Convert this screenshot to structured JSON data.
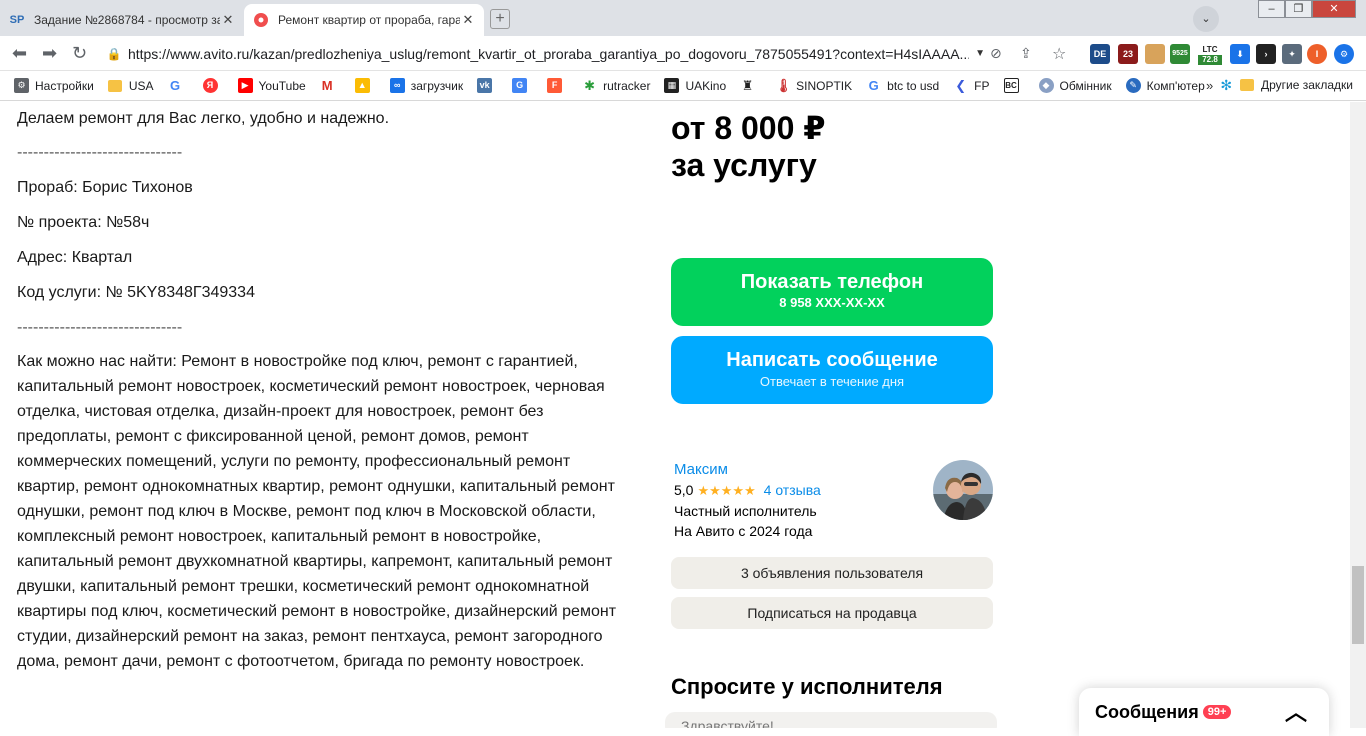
{
  "browser": {
    "tabs": [
      {
        "favicon": "SP",
        "title": "Задание №2868784 - просмотр за"
      },
      {
        "favicon": "avito-icon",
        "title": "Ремонт квартир от прораба, гара"
      }
    ],
    "url": "https://www.avito.ru/kazan/predlozheniya_uslug/remont_kvartir_ot_prorabа_garantiya_po_dogovoru_7875055491?context=H4sIAAAA...",
    "extensions": {
      "ltc_label": "LTC",
      "ltc_value": "72.8",
      "badge_23": "23",
      "badge_de": "DE",
      "badge_num": "9525",
      "profile_initial": "I"
    },
    "bookmarks": [
      "Настройки",
      "USA",
      "",
      "",
      "YouTube",
      "",
      "",
      "загрузчик",
      "",
      "",
      "",
      "rutracker",
      "UAKino",
      "",
      "SINOPTIK",
      "btc to usd",
      "FP",
      "",
      "Обмінник",
      "Комп'ютер",
      ""
    ],
    "bookmarks_more": "»",
    "bookmarks_other": "Другие закладки"
  },
  "page": {
    "intro_line": "Делаем ремонт для Вас легко, удобно и надежно.",
    "divider": "-------------------------------",
    "foreman": "Прораб: Борис Тихонов",
    "project": "№ проекта: №58ч",
    "address": "Адрес: Квартал",
    "service_code": "Код услуги: № 5KY8348Г349334",
    "search_text": "Как можно нас найти: Ремонт в новостройке под ключ, ремонт с гарантией, капитальный ремонт новостроек, косметический ремонт новостроек, черновая отделка, чистовая отделка, дизайн-проект для новостроек, ремонт без предоплаты, ремонт с фиксированной ценой, ремонт домов, ремонт коммерческих помещений, услуги по ремонту, профессиональный ремонт квартир, ремонт однокомнатных квартир, ремонт однушки, капитальный ремонт однушки, ремонт под ключ в Москве, ремонт под ключ в Московской области, комплексный ремонт новостроек, капитальный ремонт в новостройке, капитальный ремонт двухкомнатной квартиры, капремонт, капитальный ремонт двушки, капитальный ремонт трешки, косметический ремонт однокомнатной квартиры под ключ, косметический ремонт в новостройке, дизайнерский ремонт студии, дизайнерский ремонт на заказ, ремонт пентхауса, ремонт загородного дома, ремонт дачи, ремонт с фотоотчетом, бригада по ремонту новостроек.",
    "price_line1": "от 8 000 ₽",
    "price_line2": "за услугу",
    "phone_button": {
      "label": "Показать телефон",
      "sub": "8 958 XXX-XX-XX"
    },
    "message_button": {
      "label": "Написать сообщение",
      "sub": "Отвечает в течение дня"
    },
    "seller": {
      "name": "Максим",
      "rating": "5,0",
      "stars": "★★★★★",
      "reviews": "4 отзыва",
      "type": "Частный исполнитель",
      "since": "На Авито с 2024 года"
    },
    "listings_button": "3 объявления пользователя",
    "subscribe_button": "Подписаться на продавца",
    "ask_title": "Спросите у исполнителя",
    "ask_input_placeholder": "Здравствуйте!"
  },
  "messages_widget": {
    "label": "Сообщения",
    "badge": "99+"
  }
}
